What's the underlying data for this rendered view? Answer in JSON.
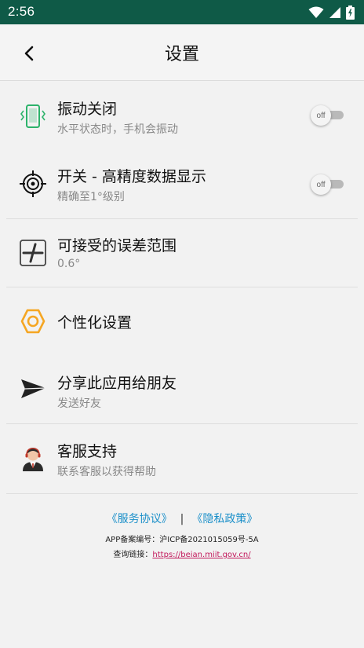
{
  "status_bar": {
    "time": "2:56",
    "icons": [
      "wifi-icon",
      "signal-icon",
      "battery-charging-icon"
    ]
  },
  "header": {
    "title": "设置",
    "back_icon": "chevron-left-icon"
  },
  "settings": [
    {
      "id": "vibration",
      "icon": "phone-vibrate-icon",
      "title": "振动关闭",
      "subtitle": "水平状态时，手机会振动",
      "toggle": "off"
    },
    {
      "id": "precision",
      "icon": "crosshair-target-icon",
      "title": "开关 - 高精度数据显示",
      "subtitle": "精确至1°级别",
      "toggle": "off"
    },
    {
      "id": "tolerance",
      "icon": "plus-tolerance-icon",
      "title": "可接受的误差范围",
      "subtitle": "0.6°"
    },
    {
      "id": "personalize",
      "icon": "hexagon-nut-icon",
      "title": "个性化设置"
    },
    {
      "id": "share",
      "icon": "paper-plane-icon",
      "title": "分享此应用给朋友",
      "subtitle": "发送好友"
    },
    {
      "id": "support",
      "icon": "customer-service-avatar-icon",
      "title": "客服支持",
      "subtitle": "联系客服以获得帮助"
    }
  ],
  "footer": {
    "service_agreement": "《服务协议》",
    "separator": "|",
    "privacy_policy": "《隐私政策》",
    "icp": "APP备案编号：沪ICP备2021015059号-5A",
    "query_label": "查询链接：",
    "query_url": "https://beian.miit.gov.cn/"
  },
  "colors": {
    "status_bar": "#0f5a47",
    "accent_green": "#2db36b",
    "accent_orange": "#f5a623",
    "link_blue": "#1a8fc9",
    "link_red": "#c2185b"
  }
}
